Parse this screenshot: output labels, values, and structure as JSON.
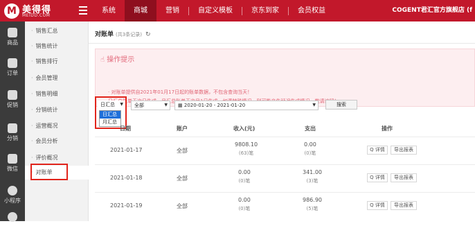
{
  "colors": {
    "brand": "#c2182b",
    "brand_dark": "#8e0f1e",
    "highlight_box": "#e1241b",
    "notice_text": "#e06474",
    "dropdown_selected": "#1e6fd9"
  },
  "header": {
    "logo_name": "美得得",
    "logo_sub": "MEIDD.COM",
    "menu_icon": "hamburger-icon",
    "nav": [
      {
        "label": "系统",
        "active": false
      },
      {
        "label": "商城",
        "active": true
      },
      {
        "label": "营销",
        "active": false
      },
      {
        "label": "自定义模板",
        "active": false
      },
      {
        "label": "京东到家",
        "active": false
      },
      {
        "label": "会员权益",
        "active": false
      }
    ],
    "shop_name": "COGENT君汇官方旗舰店 (f"
  },
  "leftbar": [
    {
      "label": "商品",
      "icon": "bag-icon"
    },
    {
      "label": "订单",
      "icon": "order-icon"
    },
    {
      "label": "促销",
      "icon": "promo-icon"
    },
    {
      "label": "分销",
      "icon": "distribution-icon"
    },
    {
      "label": "微信",
      "icon": "wechat-icon"
    },
    {
      "label": "小程序",
      "icon": "miniprogram-icon"
    },
    {
      "label": "",
      "icon": "more-icon"
    }
  ],
  "submenu": [
    {
      "label": "销售汇总",
      "active": false
    },
    {
      "label": "销售统计",
      "active": false
    },
    {
      "label": "销售排行",
      "active": false
    },
    {
      "label": "会员管理",
      "active": false
    },
    {
      "label": "销售明细",
      "active": false
    },
    {
      "label": "分销统计",
      "active": false
    },
    {
      "label": "运营概况",
      "active": false
    },
    {
      "label": "会员分析",
      "active": false
    },
    {
      "label": "评价概况",
      "active": false
    },
    {
      "label": "对账单",
      "active": true
    }
  ],
  "page": {
    "title": "对账单",
    "record_count": "(共3条记录)",
    "refresh_icon": "refresh-icon"
  },
  "notice": {
    "title": "操作提示",
    "icon": "hand-pointer-icon",
    "lines": [
      "· 对账单提供自2021年01月17日起的账单数据，不包含查询当天！",
      "日汇总账单于次日生成，月汇总账单于次月1日生成，如遇特殊情况，则可能产生延迟生成情况，敬请谅解！"
    ]
  },
  "filters": {
    "period": {
      "value": "日汇总",
      "options": [
        "日汇总",
        "月汇总"
      ],
      "selected_index": 0
    },
    "account": {
      "value": "全部"
    },
    "date_range": {
      "value": "2020-01-20 - 2021-01-20",
      "icon": "calendar-icon"
    },
    "search_label": "搜索"
  },
  "table": {
    "headers": [
      "日期",
      "账户",
      "收入(元)",
      "支出",
      "操作"
    ],
    "rows": [
      {
        "date": "2021-01-17",
        "account": "全部",
        "income": "9808.10",
        "income_count": "(63)笔",
        "expense": "0.00",
        "expense_count": "(0)笔"
      },
      {
        "date": "2021-01-18",
        "account": "全部",
        "income": "0.00",
        "income_count": "(0)笔",
        "expense": "341.00",
        "expense_count": "(3)笔"
      },
      {
        "date": "2021-01-19",
        "account": "全部",
        "income": "0.00",
        "income_count": "(0)笔",
        "expense": "986.90",
        "expense_count": "(5)笔"
      }
    ],
    "detail_label": "Q 详情",
    "export_label": "导出报表"
  }
}
